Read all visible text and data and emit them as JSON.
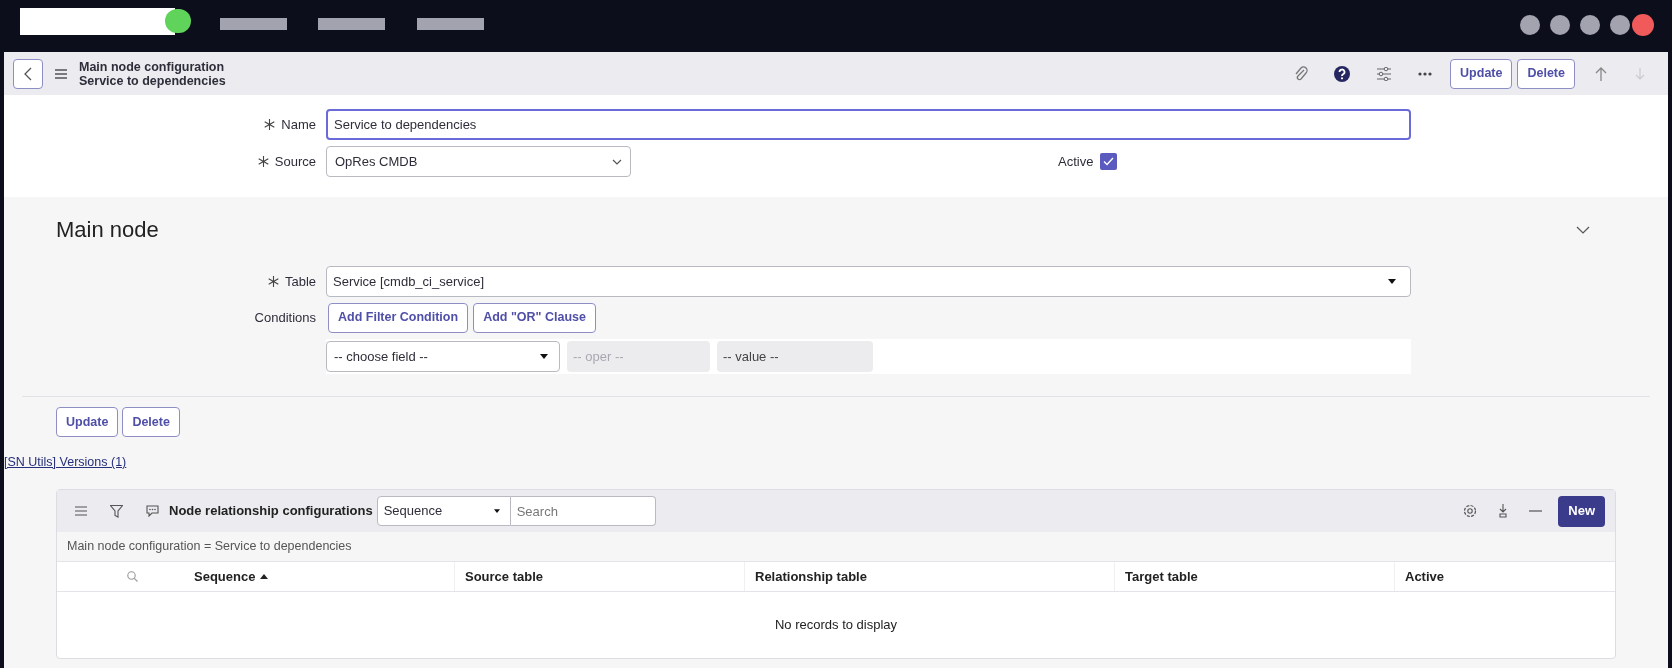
{
  "header": {
    "title": "Main node configuration",
    "subtitle": "Service to dependencies",
    "buttons": [
      "Update",
      "Delete"
    ]
  },
  "form": {
    "fields": [
      {
        "label": "Name",
        "required": true,
        "kind": "text",
        "value": "Service to dependencies",
        "focused": true
      },
      {
        "label": "Source",
        "required": true,
        "kind": "select",
        "value": "OpRes CMDB",
        "focused": false
      }
    ],
    "active": {
      "label": "Active",
      "checked": true
    }
  },
  "section": {
    "title": "Main node",
    "expanded": true,
    "table_field": {
      "label": "Table",
      "required": true,
      "value": "Service [cmdb_ci_service]"
    },
    "conditions": {
      "label": "Conditions",
      "buttons": [
        "Add Filter Condition",
        "Add \"OR\" Clause"
      ],
      "field": "-- choose field --",
      "operator": "-- oper --",
      "value": "-- value --"
    }
  },
  "form_buttons": [
    "Update",
    "Delete"
  ],
  "link": "[SN Utils] Versions (1)",
  "related_list": {
    "title": "Node relationship configurations",
    "search_field": "Sequence",
    "search_placeholder": "Search",
    "new_button": "New",
    "breadcrumb": "Main node configuration = Service to dependencies",
    "columns": [
      {
        "label": "Sequence",
        "sorted": true
      },
      {
        "label": "Source table",
        "sorted": false
      },
      {
        "label": "Relationship table",
        "sorted": false
      },
      {
        "label": "Target table",
        "sorted": false
      },
      {
        "label": "Active",
        "sorted": false
      }
    ],
    "empty_message": "No records to display"
  }
}
